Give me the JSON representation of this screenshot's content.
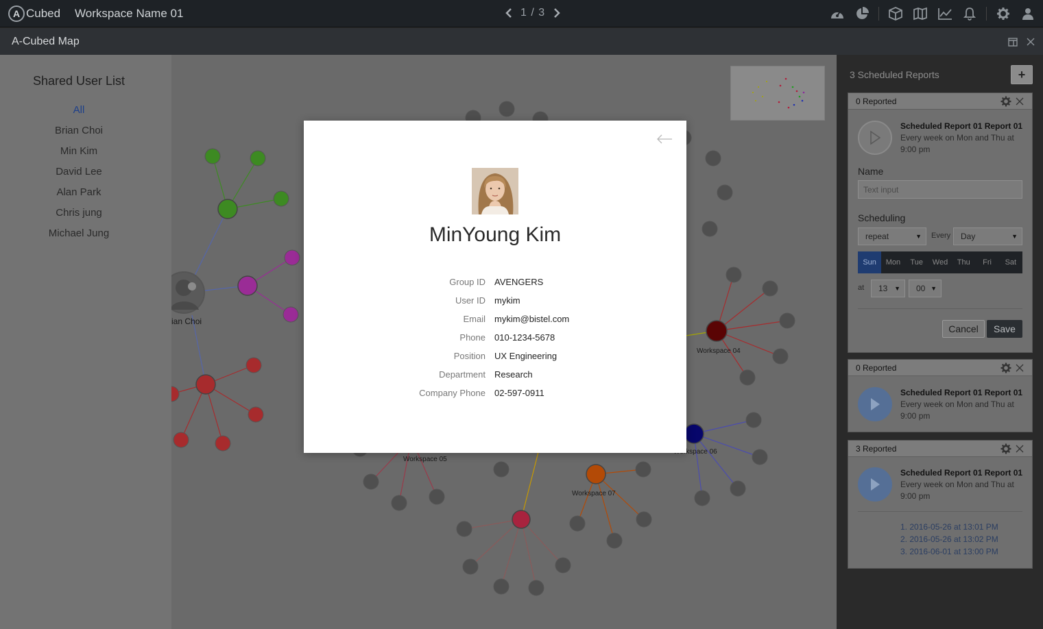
{
  "topbar": {
    "logo_letter": "A",
    "logo_text": "Cubed",
    "workspace_name": "Workspace Name 01",
    "pager": "1 / 3",
    "icons": [
      "dashboard-icon",
      "pie-chart-icon",
      "cube-icon",
      "map-icon",
      "line-chart-icon",
      "bell-icon",
      "gear-icon",
      "user-icon"
    ]
  },
  "subbar": {
    "title": "A-Cubed Map"
  },
  "userlist": {
    "title": "Shared User List",
    "items": [
      "All",
      "Brian Choi",
      "Min Kim",
      "David Lee",
      "Alan Park",
      "Chris jung",
      "Michael Jung"
    ]
  },
  "graph_labels": {
    "brian": "ian Choi",
    "ws04": "Workspace 04",
    "ws05": "Workspace 05",
    "ws06": "Workspace 06",
    "ws07": "Workspace 07"
  },
  "colors": {
    "green": "#3d8a22",
    "purple": "#9a2c96",
    "red": "#a72b2d",
    "darkred": "#5a0404",
    "navy": "#07066b",
    "orange": "#b34a06",
    "crimson": "#a8233e",
    "grey_node": "#4f4f4f",
    "accent_blue": "#1f3c71"
  },
  "panel": {
    "heading": "3 Scheduled Reports",
    "add": "+",
    "cards": [
      {
        "reported": "0 Reported",
        "title": "Scheduled Report 01 Report 01",
        "desc": "Every week on Mon and Thu at 9:00 pm",
        "name_label": "Name",
        "name_placeholder": "Text input",
        "scheduling_label": "Scheduling",
        "repeat": "repeat",
        "every_label": "Every",
        "every_value": "Day",
        "days": [
          "Sun",
          "Mon",
          "Tue",
          "Wed",
          "Thu",
          "Fri",
          "Sat"
        ],
        "at_label": "at",
        "hour": "13",
        "minute": "00",
        "cancel": "Cancel",
        "save": "Save"
      },
      {
        "reported": "0 Reported",
        "title": "Scheduled Report 01 Report 01",
        "desc": "Every week on Mon and Thu at 9:00 pm"
      },
      {
        "reported": "3 Reported",
        "title": "Scheduled Report 01 Report 01",
        "desc": "Every week on Mon and Thu at 9:00 pm",
        "history": [
          "1. 2016-05-26 at 13:01 PM",
          "2. 2016-05-26 at 13:02 PM",
          "3. 2016-06-01 at 13:00 PM"
        ]
      }
    ]
  },
  "modal": {
    "name": "MinYoung Kim",
    "fields": [
      {
        "label": "Group ID",
        "value": "AVENGERS"
      },
      {
        "label": "User ID",
        "value": "mykim"
      },
      {
        "label": "Email",
        "value": "mykim@bistel.com"
      },
      {
        "label": "Phone",
        "value": "010-1234-5678"
      },
      {
        "label": "Position",
        "value": "UX Engineering"
      },
      {
        "label": "Department",
        "value": "Research"
      },
      {
        "label": "Company Phone",
        "value": "02-597-0911"
      }
    ]
  }
}
